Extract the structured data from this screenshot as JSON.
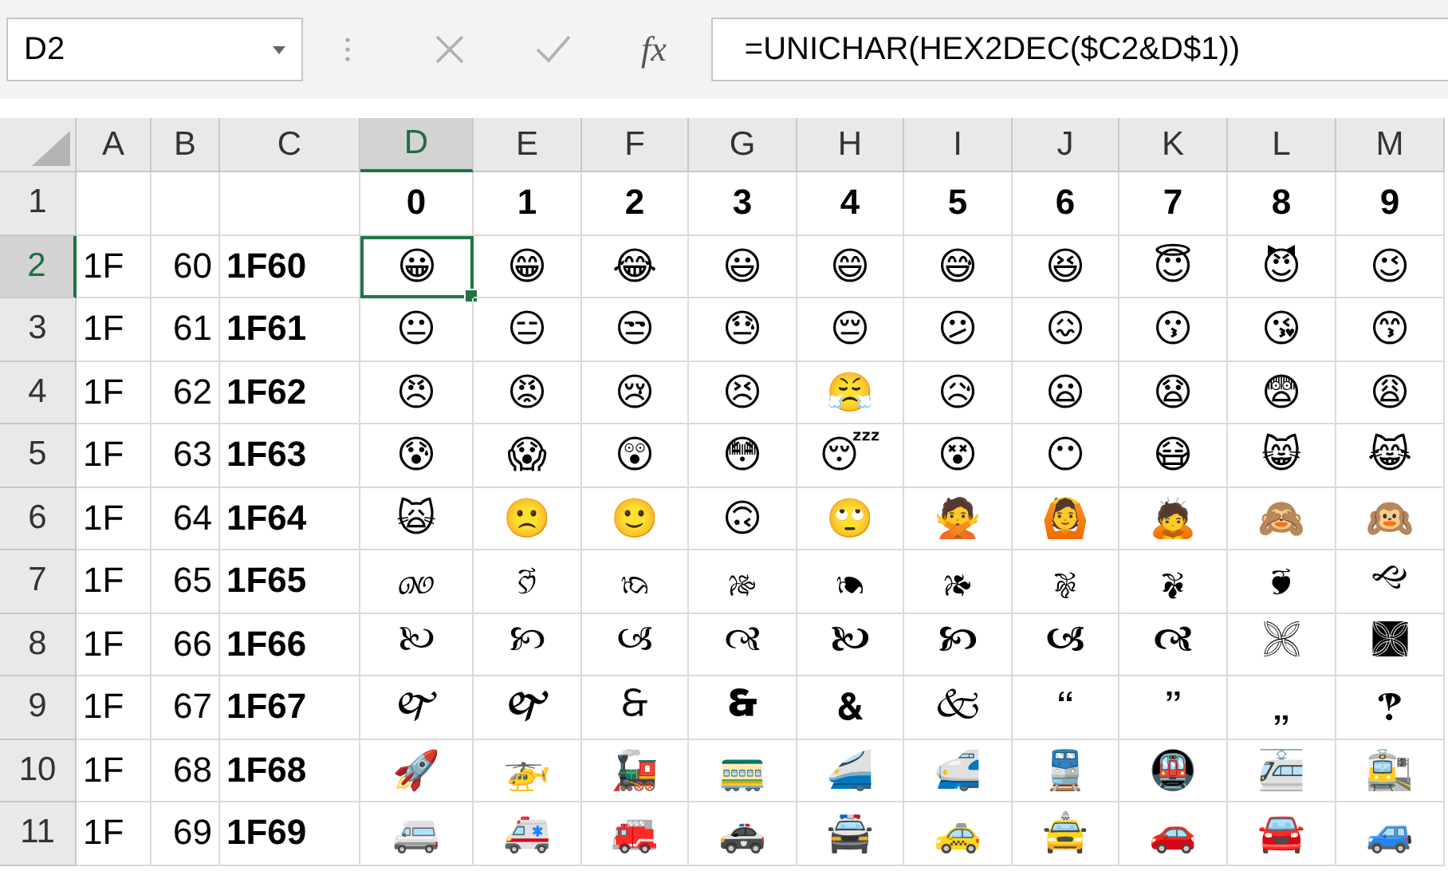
{
  "name_box": {
    "value": "D2"
  },
  "formula_bar": {
    "function_label": "fx",
    "formula": "=UNICHAR(HEX2DEC($C2&D$1))"
  },
  "columns": [
    {
      "label": "A",
      "selected": false
    },
    {
      "label": "B",
      "selected": false
    },
    {
      "label": "C",
      "selected": false
    },
    {
      "label": "D",
      "selected": true
    },
    {
      "label": "E",
      "selected": false
    },
    {
      "label": "F",
      "selected": false
    },
    {
      "label": "G",
      "selected": false
    },
    {
      "label": "H",
      "selected": false
    },
    {
      "label": "I",
      "selected": false
    },
    {
      "label": "J",
      "selected": false
    },
    {
      "label": "K",
      "selected": false
    },
    {
      "label": "L",
      "selected": false
    },
    {
      "label": "M",
      "selected": false
    }
  ],
  "header_row": {
    "header": "1",
    "selected": false,
    "digits": [
      "0",
      "1",
      "2",
      "3",
      "4",
      "5",
      "6",
      "7",
      "8",
      "9"
    ]
  },
  "rows": [
    {
      "header": "2",
      "selected": true,
      "a": "1F",
      "b": "60",
      "c": "1F60",
      "chars": [
        "😀",
        "😁",
        "😂",
        "😃",
        "😄",
        "😅",
        "😆",
        "😇",
        "😈",
        "😉"
      ]
    },
    {
      "header": "3",
      "selected": false,
      "a": "1F",
      "b": "61",
      "c": "1F61",
      "chars": [
        "😐",
        "😑",
        "😒",
        "😓",
        "😔",
        "😕",
        "😖",
        "😗",
        "😘",
        "😙"
      ]
    },
    {
      "header": "4",
      "selected": false,
      "a": "1F",
      "b": "62",
      "c": "1F62",
      "chars": [
        "😠",
        "😡",
        "😢",
        "😣",
        "😤",
        "😥",
        "😦",
        "😧",
        "😨",
        "😩"
      ]
    },
    {
      "header": "5",
      "selected": false,
      "a": "1F",
      "b": "63",
      "c": "1F63",
      "chars": [
        "😰",
        "😱",
        "😲",
        "😳",
        "😴",
        "😵",
        "😶",
        "😷",
        "😸",
        "😹"
      ]
    },
    {
      "header": "6",
      "selected": false,
      "a": "1F",
      "b": "64",
      "c": "1F64",
      "chars": [
        "🙀",
        "🙁",
        "🙂",
        "🙃",
        "🙄",
        "🙅",
        "🙆",
        "🙇",
        "🙈",
        "🙉"
      ]
    },
    {
      "header": "7",
      "selected": false,
      "a": "1F",
      "b": "65",
      "c": "1F65",
      "chars": [
        "🙐",
        "🙑",
        "🙒",
        "🙓",
        "🙔",
        "🙕",
        "🙖",
        "🙗",
        "🙘",
        "🙙"
      ]
    },
    {
      "header": "8",
      "selected": false,
      "a": "1F",
      "b": "66",
      "c": "1F66",
      "chars": [
        "🙠",
        "🙡",
        "🙢",
        "🙣",
        "🙤",
        "🙥",
        "🙦",
        "🙧",
        "🙨",
        "🙩"
      ]
    },
    {
      "header": "9",
      "selected": false,
      "a": "1F",
      "b": "67",
      "c": "1F67",
      "chars": [
        "🙰",
        "🙱",
        "🙲",
        "🙳",
        "🙴",
        "🙵",
        "🙶",
        "🙷",
        "🙸",
        "🙹"
      ]
    },
    {
      "header": "10",
      "selected": false,
      "a": "1F",
      "b": "68",
      "c": "1F68",
      "chars": [
        "🚀",
        "🚁",
        "🚂",
        "🚃",
        "🚄",
        "🚅",
        "🚆",
        "🚇",
        "🚈",
        "🚉"
      ]
    },
    {
      "header": "11",
      "selected": false,
      "a": "1F",
      "b": "69",
      "c": "1F69",
      "chars": [
        "🚐",
        "🚑",
        "🚒",
        "🚓",
        "🚔",
        "🚕",
        "🚖",
        "🚗",
        "🚘",
        "🚙"
      ]
    }
  ]
}
